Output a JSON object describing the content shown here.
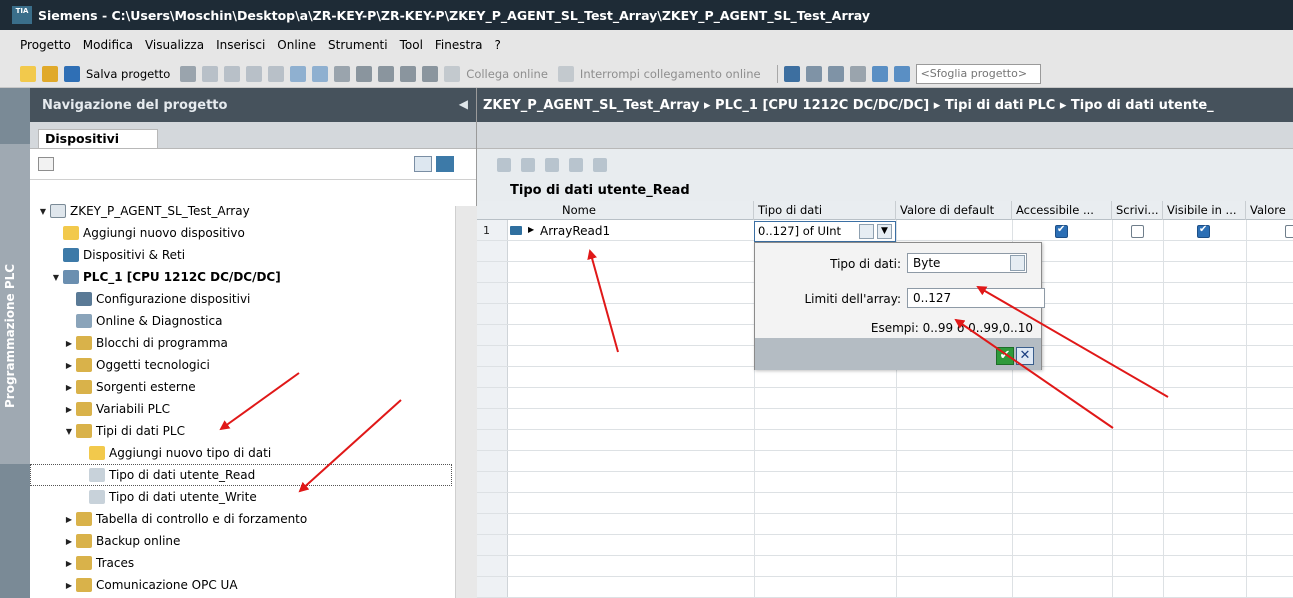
{
  "window": {
    "title": "Siemens  -  C:\\Users\\Moschin\\Desktop\\a\\ZR-KEY-P\\ZR-KEY-P\\ZKEY_P_AGENT_SL_Test_Array\\ZKEY_P_AGENT_SL_Test_Array",
    "logo_text": "TIA"
  },
  "menu": [
    "Progetto",
    "Modifica",
    "Visualizza",
    "Inserisci",
    "Online",
    "Strumenti",
    "Tool",
    "Finestra",
    "?"
  ],
  "toolbar": {
    "save_label": "Salva progetto",
    "go_online_label": "Collega online",
    "go_offline_label": "Interrompi collegamento online",
    "search_placeholder": "<Sfoglia progetto>"
  },
  "vertical_tab": {
    "label": "Programmazione PLC"
  },
  "navigation": {
    "header": "Navigazione del progetto",
    "tab": "Dispositivi",
    "tree": [
      {
        "label": "ZKEY_P_AGENT_SL_Test_Array",
        "level": 0,
        "expander": "open",
        "icon": "project-icon"
      },
      {
        "label": "Aggiungi nuovo dispositivo",
        "level": 1,
        "expander": "none",
        "icon": "add-device-icon"
      },
      {
        "label": "Dispositivi & Reti",
        "level": 1,
        "expander": "none",
        "icon": "network-icon"
      },
      {
        "label": "PLC_1 [CPU 1212C DC/DC/DC]",
        "level": 1,
        "expander": "open",
        "icon": "plc-icon",
        "bold": true
      },
      {
        "label": "Configurazione dispositivi",
        "level": 2,
        "expander": "none",
        "icon": "device-config-icon"
      },
      {
        "label": "Online & Diagnostica",
        "level": 2,
        "expander": "none",
        "icon": "diagnostics-icon"
      },
      {
        "label": "Blocchi di programma",
        "level": 2,
        "expander": "closed",
        "icon": "folder-icon"
      },
      {
        "label": "Oggetti tecnologici",
        "level": 2,
        "expander": "closed",
        "icon": "folder-icon"
      },
      {
        "label": "Sorgenti esterne",
        "level": 2,
        "expander": "closed",
        "icon": "folder-icon"
      },
      {
        "label": "Variabili PLC",
        "level": 2,
        "expander": "closed",
        "icon": "folder-icon"
      },
      {
        "label": "Tipi di dati PLC",
        "level": 2,
        "expander": "open",
        "icon": "folder-icon"
      },
      {
        "label": "Aggiungi nuovo tipo di dati",
        "level": 3,
        "expander": "none",
        "icon": "add-type-icon"
      },
      {
        "label": "Tipo di dati utente_Read",
        "level": 3,
        "expander": "none",
        "icon": "udt-icon",
        "selected": true
      },
      {
        "label": "Tipo di dati utente_Write",
        "level": 3,
        "expander": "none",
        "icon": "udt-icon"
      },
      {
        "label": "Tabella di controllo e di forzamento",
        "level": 2,
        "expander": "closed",
        "icon": "folder-icon"
      },
      {
        "label": "Backup online",
        "level": 2,
        "expander": "closed",
        "icon": "folder-icon"
      },
      {
        "label": "Traces",
        "level": 2,
        "expander": "closed",
        "icon": "folder-icon"
      },
      {
        "label": "Comunicazione OPC UA",
        "level": 2,
        "expander": "closed",
        "icon": "folder-icon"
      }
    ]
  },
  "editor": {
    "breadcrumb": "ZKEY_P_AGENT_SL_Test_Array ▸ PLC_1 [CPU 1212C DC/DC/DC] ▸ Tipi di dati PLC ▸ Tipo di dati utente_",
    "type_title": "Tipo di dati utente_Read",
    "columns": [
      "Nome",
      "Tipo di dati",
      "Valore di default",
      "Accessibile ...",
      "Scrivi...",
      "Visibile in ...",
      "Valore"
    ],
    "rows": [
      {
        "num": "1",
        "name": "ArrayRead1",
        "type": "0..127] of UInt",
        "accessible": true,
        "writable": false,
        "visible": true
      }
    ]
  },
  "popup": {
    "type_label": "Tipo di dati:",
    "type_value": "Byte",
    "limits_label": "Limiti dell'array:",
    "limits_value": "0..127",
    "examples": "Esempi: 0..99 o 0..99,0..10",
    "ok_symbol": "✔",
    "cancel_symbol": "✕"
  },
  "colors": {
    "title_bar": "#1e2b36",
    "panel_header": "#46525c",
    "annotation_red": "#e01818",
    "ok_green": "#2e9a3b"
  }
}
